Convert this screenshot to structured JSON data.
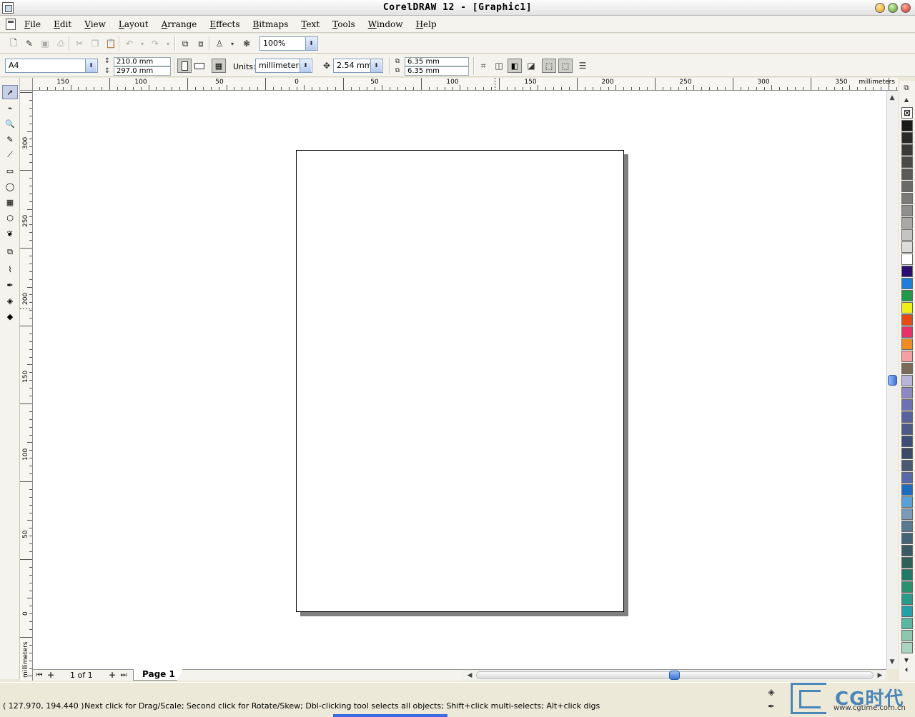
{
  "window": {
    "title": "CorelDRAW 12 - [Graphic1]"
  },
  "menu": [
    "File",
    "Edit",
    "View",
    "Layout",
    "Arrange",
    "Effects",
    "Bitmaps",
    "Text",
    "Tools",
    "Window",
    "Help"
  ],
  "standard_toolbar": {
    "zoom_value": "100%"
  },
  "property_bar": {
    "paper_size": "A4",
    "width": "210.0 mm",
    "height": "297.0 mm",
    "units_label": "Units:",
    "units_value": "millimeters",
    "nudge": "2.54 mm",
    "dup_x": "6.35 mm",
    "dup_y": "6.35 mm"
  },
  "rulers": {
    "unit_label": "millimeters",
    "h_labels": [
      "150",
      "100",
      "50",
      "0",
      "50",
      "100",
      "150",
      "200",
      "250",
      "300",
      "350"
    ],
    "v_labels": [
      "300",
      "250",
      "200",
      "150",
      "100",
      "50",
      "0"
    ],
    "v_unit": "millimeters"
  },
  "page_nav": {
    "counter": "1 of 1",
    "tab": "Page 1"
  },
  "palette_colors": [
    "#1a1a1a",
    "#2a2a2a",
    "#3a3a3a",
    "#4a4a4a",
    "#5a5a5a",
    "#6a6a6a",
    "#7a7a7a",
    "#8e8e8e",
    "#a8a8a8",
    "#c4c4c4",
    "#dcdcdc",
    "#ffffff",
    "#2a0f6e",
    "#1e7fd8",
    "#1f9a4a",
    "#f2ee18",
    "#e84a14",
    "#e8306a",
    "#f08c22",
    "#f4a0a0",
    "#7a6a5a",
    "#b9b4d8",
    "#8e88c0",
    "#6e70b4",
    "#58609e",
    "#4c5a8a",
    "#3c4e78",
    "#3a4a66",
    "#4a5a72",
    "#5868a8",
    "#1c6cc0",
    "#58a0d8",
    "#7a9ab8",
    "#5a7890",
    "#466478",
    "#3a5a66",
    "#2c6058",
    "#207a66",
    "#2a9070",
    "#2a9a8a",
    "#26a0a8",
    "#5ab8a0",
    "#8cc8b0",
    "#a8d4c0"
  ],
  "status": {
    "coords": "( 127.970, 194.440 )",
    "hint": "Next click for Drag/Scale; Second click for Rotate/Skew; Dbl-clicking tool selects all objects; Shift+click multi-selects; Alt+click digs"
  },
  "watermark": {
    "brand": "CG时代",
    "url": "www.cgtime.com.cn"
  },
  "colors": {
    "selection_blue": "#3d73d6",
    "page_shadow": "#808080"
  }
}
